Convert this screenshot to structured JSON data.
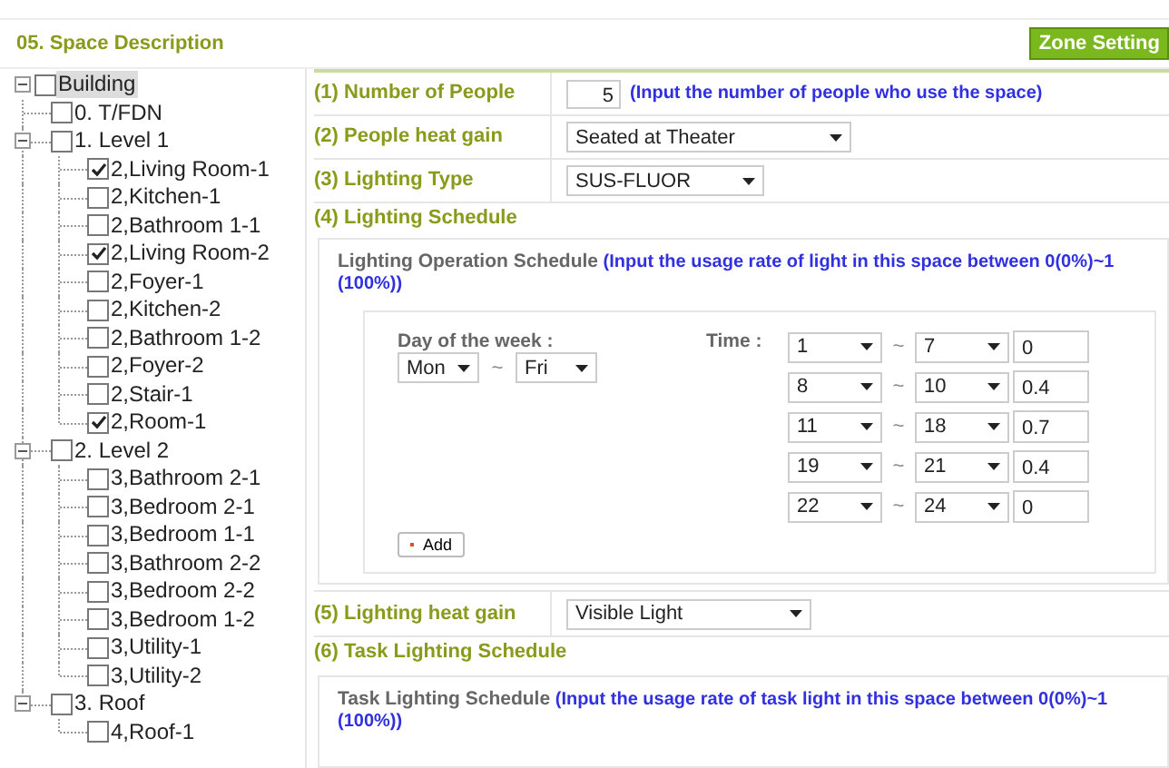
{
  "header": {
    "title": "05. Space Description",
    "button": "Zone Setting"
  },
  "tree": [
    {
      "label": "Building",
      "checked": false,
      "selected": true,
      "expanded": true,
      "children": [
        {
          "label": "0. T/FDN",
          "checked": false,
          "selected": false
        },
        {
          "label": "1. Level 1",
          "checked": false,
          "selected": false,
          "expanded": true,
          "children": [
            {
              "label": "2,Living Room-1",
              "checked": true,
              "selected": false
            },
            {
              "label": "2,Kitchen-1",
              "checked": false,
              "selected": false
            },
            {
              "label": "2,Bathroom 1-1",
              "checked": false,
              "selected": false
            },
            {
              "label": "2,Living Room-2",
              "checked": true,
              "selected": false
            },
            {
              "label": "2,Foyer-1",
              "checked": false,
              "selected": false
            },
            {
              "label": "2,Kitchen-2",
              "checked": false,
              "selected": false
            },
            {
              "label": "2,Bathroom 1-2",
              "checked": false,
              "selected": false
            },
            {
              "label": "2,Foyer-2",
              "checked": false,
              "selected": false
            },
            {
              "label": "2,Stair-1",
              "checked": false,
              "selected": false
            },
            {
              "label": "2,Room-1",
              "checked": true,
              "selected": false
            }
          ]
        },
        {
          "label": "2. Level 2",
          "checked": false,
          "selected": false,
          "expanded": true,
          "children": [
            {
              "label": "3,Bathroom 2-1",
              "checked": false,
              "selected": false
            },
            {
              "label": "3,Bedroom 2-1",
              "checked": false,
              "selected": false
            },
            {
              "label": "3,Bedroom 1-1",
              "checked": false,
              "selected": false
            },
            {
              "label": "3,Bathroom 2-2",
              "checked": false,
              "selected": false
            },
            {
              "label": "3,Bedroom 2-2",
              "checked": false,
              "selected": false
            },
            {
              "label": "3,Bedroom 1-2",
              "checked": false,
              "selected": false
            },
            {
              "label": "3,Utility-1",
              "checked": false,
              "selected": false
            },
            {
              "label": "3,Utility-2",
              "checked": false,
              "selected": false
            }
          ]
        },
        {
          "label": "3. Roof",
          "checked": false,
          "selected": false,
          "expanded": true,
          "children": [
            {
              "label": "4,Roof-1",
              "checked": false,
              "selected": false
            }
          ]
        }
      ]
    }
  ],
  "form": {
    "number_of_people": {
      "label": "(1) Number of People",
      "value": "5",
      "hint": "(Input the number of people who use the space)"
    },
    "people_heat_gain": {
      "label": "(2) People heat gain",
      "value": "Seated at Theater"
    },
    "lighting_type": {
      "label": "(3) Lighting Type",
      "value": "SUS-FLUOR"
    },
    "lighting_schedule": {
      "label": "(4) Lighting Schedule",
      "title": "Lighting Operation Schedule",
      "hint": "(Input the usage rate of light in this space between 0(0%)~1 (100%))",
      "day_label": "Day of the week :",
      "day_from": "Mon",
      "day_tilde": "~",
      "day_to": "Fri",
      "time_label": "Time :",
      "time_rows": [
        {
          "from": "1",
          "tilde": "~",
          "to": "7",
          "rate": "0"
        },
        {
          "from": "8",
          "tilde": "~",
          "to": "10",
          "rate": "0.4"
        },
        {
          "from": "11",
          "tilde": "~",
          "to": "18",
          "rate": "0.7"
        },
        {
          "from": "19",
          "tilde": "~",
          "to": "21",
          "rate": "0.4"
        },
        {
          "from": "22",
          "tilde": "~",
          "to": "24",
          "rate": "0"
        }
      ],
      "add_button": "Add"
    },
    "lighting_heat_gain": {
      "label": "(5) Lighting heat gain",
      "value": "Visible Light"
    },
    "task_lighting_schedule": {
      "label": "(6) Task Lighting Schedule",
      "title": "Task Lighting Schedule",
      "hint": "(Input the usage rate of task light in this space between 0(0%)~1 (100%))"
    }
  }
}
